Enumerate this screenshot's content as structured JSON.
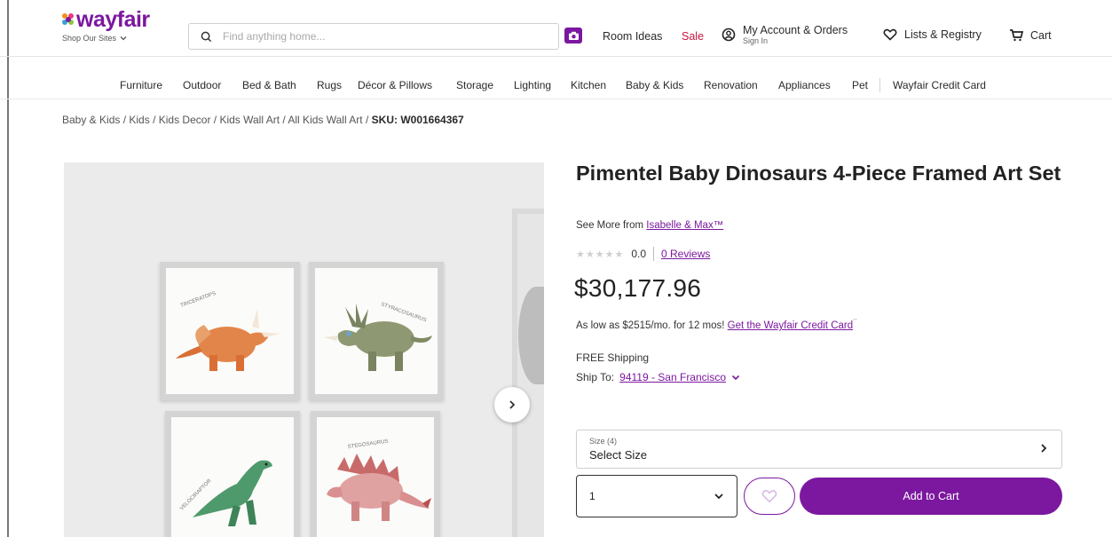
{
  "header": {
    "logo_text": "wayfair",
    "shop_our_sites": "Shop Our Sites",
    "search_placeholder": "Find anything home...",
    "room_ideas": "Room Ideas",
    "sale": "Sale",
    "account_main": "My Account & Orders",
    "account_sub": "Sign In",
    "lists": "Lists & Registry",
    "cart": "Cart",
    "brand_color": "#7b189f",
    "sale_color": "#c4163e"
  },
  "nav": {
    "items": [
      "Furniture",
      "Outdoor",
      "Bed & Bath",
      "Rugs",
      "Décor & Pillows",
      "Storage",
      "Lighting",
      "Kitchen",
      "Baby & Kids",
      "Renovation",
      "Appliances",
      "Pet"
    ],
    "credit_card": "Wayfair Credit Card"
  },
  "breadcrumb": {
    "items": [
      "Baby & Kids",
      "Kids",
      "Kids Decor",
      "Kids Wall Art",
      "All Kids Wall Art"
    ],
    "separator": "/",
    "sku": "SKU: W001664367"
  },
  "product": {
    "title": "Pimentel Baby Dinosaurs 4-Piece Framed Art Set",
    "see_more_prefix": "See More from",
    "brand": "Isabelle & Max™",
    "rating_value": "0.0",
    "reviews_link": "0 Reviews",
    "price": "$30,177.96",
    "financing_text": "As low as $2515/mo. for 12 mos!",
    "financing_link": "Get the Wayfair Credit Card",
    "financing_mark": "´´",
    "shipping": "FREE Shipping",
    "ship_to_label": "Ship To:",
    "ship_to_location": "94119 - San Francisco",
    "size_label": "Size (4)",
    "size_value": "Select Size",
    "quantity": "1",
    "add_to_cart": "Add to Cart"
  },
  "gallery": {
    "frames": [
      {
        "caption": "TRICERATOPS"
      },
      {
        "caption": "STYRACOSAURUS"
      },
      {
        "caption": "VELOCIRAPTOR"
      },
      {
        "caption": "STEGOSAURUS"
      }
    ]
  }
}
